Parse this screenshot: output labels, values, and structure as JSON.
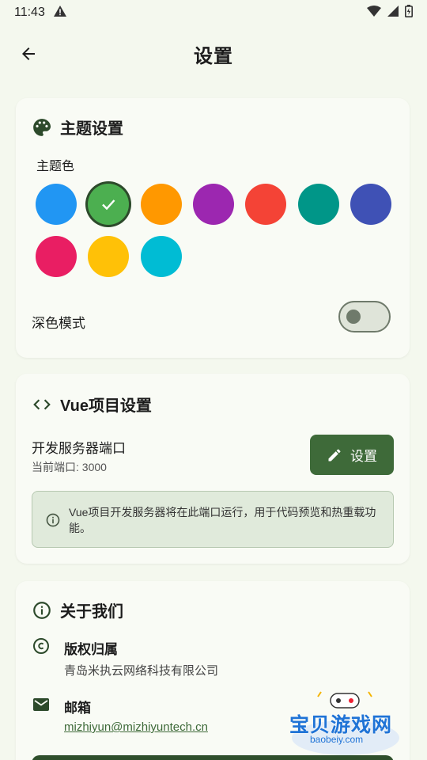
{
  "status": {
    "time": "11:43"
  },
  "header": {
    "title": "设置"
  },
  "theme": {
    "title": "主题设置",
    "color_label": "主题色",
    "colors": [
      "#2196f3",
      "#4caf50",
      "#ff9800",
      "#9c27b0",
      "#f44336",
      "#009688",
      "#3f51b5",
      "#e91e63",
      "#ffc107",
      "#00bcd4"
    ],
    "selected_index": 1,
    "dark_mode_label": "深色模式",
    "dark_mode_on": false
  },
  "vue": {
    "title": "Vue项目设置",
    "port_label": "开发服务器端口",
    "port_value": "当前端口: 3000",
    "set_button": "设置",
    "info": "Vue项目开发服务器将在此端口运行，用于代码预览和热重载功能。"
  },
  "about": {
    "title": "关于我们",
    "copyright_title": "版权归属",
    "copyright_value": "青岛米执云网络科技有限公司",
    "email_title": "邮箱",
    "email_value": "mizhiyun@mizhiyuntech.cn"
  },
  "watermark": {
    "text": "宝贝游戏网",
    "sub": "baobeiy.com"
  },
  "accent": "#3e6a39"
}
